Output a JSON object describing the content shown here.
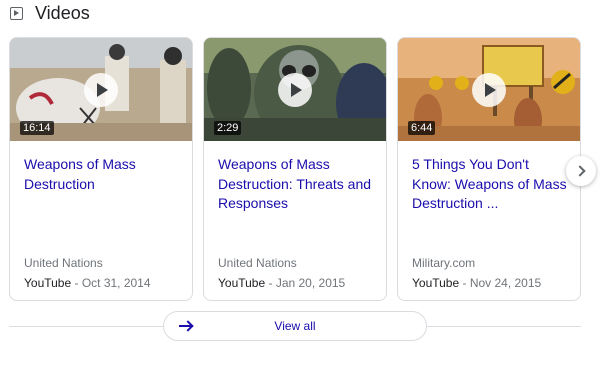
{
  "header": {
    "icon": "play-box-icon",
    "title": "Videos"
  },
  "cards": [
    {
      "duration": "16:14",
      "title": "Weapons of Mass Destruction",
      "source": "United Nations",
      "site": "YouTube",
      "date": " - Oct 31, 2014"
    },
    {
      "duration": "2:29",
      "title": "Weapons of Mass Destruction: Threats and Responses",
      "source": "United Nations",
      "site": "YouTube",
      "date": " - Jan 20, 2015"
    },
    {
      "duration": "6:44",
      "title": "5 Things You Don't Know: Weapons of Mass Destruction ...",
      "source": "Military.com",
      "site": "YouTube",
      "date": " - Nov 24, 2015"
    }
  ],
  "carousel": {
    "next_icon": "chevron-right-icon"
  },
  "footer": {
    "view_all_label": "View all",
    "arrow_icon": "arrow-right-icon"
  },
  "colors": {
    "link": "#1a0dab",
    "muted": "#70757a",
    "border": "#dadce0"
  }
}
